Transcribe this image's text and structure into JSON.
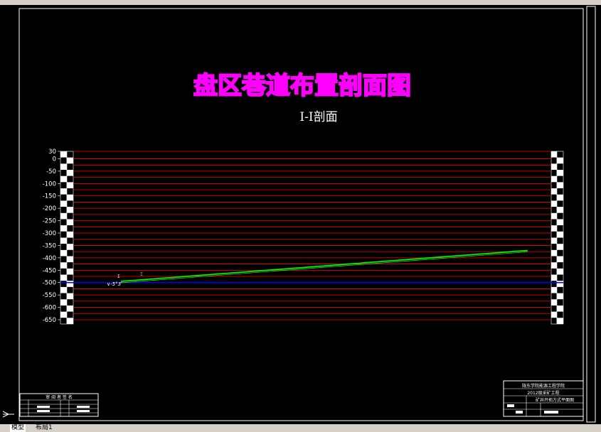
{
  "window": {
    "tabs": [
      "模型",
      "布局1"
    ],
    "active_tab": "模型"
  },
  "drawing": {
    "title": "盘区巷道布置剖面图",
    "subtitle": "I-I剖面",
    "elevation_labels": [
      "30",
      "0",
      "-50",
      "-100",
      "-150",
      "-200",
      "-250",
      "-300",
      "-350",
      "-400",
      "-450",
      "-500",
      "-550",
      "-600",
      "-650"
    ],
    "colors": {
      "background": "#000000",
      "frame": "#ffffff",
      "title": "#ff00ff",
      "grid_line": "#ff0000",
      "seam_line": "#0000ff",
      "roadway": "#00ff00",
      "text": "#ffffff"
    },
    "seam_label": "-500",
    "roadway_annotation": "∨-5°3′",
    "title_block": {
      "line1": "陇东学院能源工程学院",
      "line2": "2012级采矿工程",
      "line3": "矿井开拓方式平面图"
    },
    "revision_block": {
      "header": "审 阅 者 签 名"
    }
  },
  "chart_data": {
    "type": "line",
    "title": "I-I剖面",
    "ylabel": "",
    "xlabel": "",
    "ylim": [
      -650,
      30
    ],
    "y_ticks": [
      30,
      0,
      -50,
      -100,
      -150,
      -200,
      -250,
      -300,
      -350,
      -400,
      -450,
      -500,
      -550,
      -600,
      -650
    ],
    "series": [
      {
        "values": [
          -495,
          -370
        ]
      }
    ],
    "reference_line": -500
  }
}
